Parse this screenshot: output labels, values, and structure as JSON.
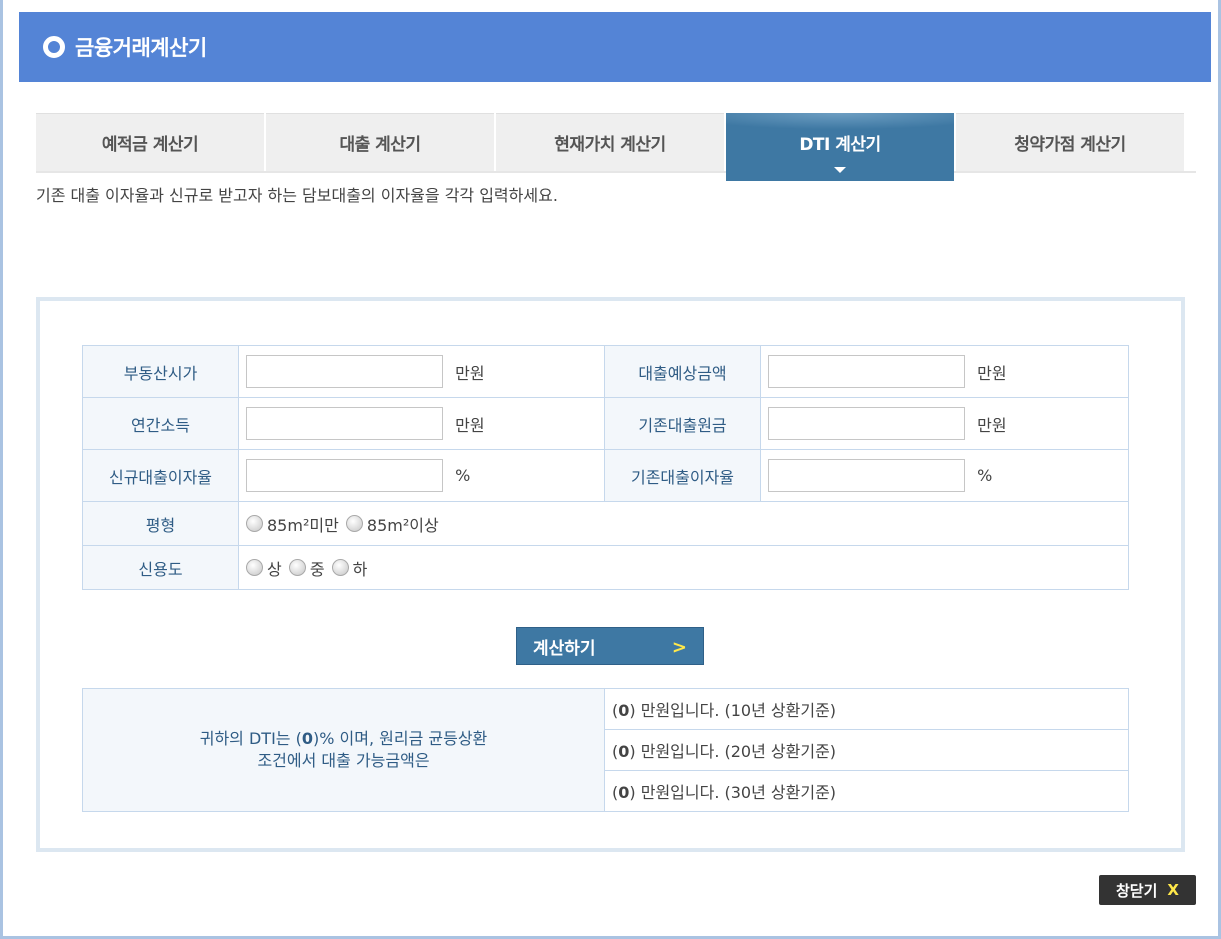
{
  "header": {
    "title": "금융거래계산기"
  },
  "tabs": [
    {
      "label": "예적금 계산기",
      "active": false
    },
    {
      "label": "대출 계산기",
      "active": false
    },
    {
      "label": "현재가치 계산기",
      "active": false
    },
    {
      "label": "DTI 계산기",
      "active": true
    },
    {
      "label": "청약가점 계산기",
      "active": false
    }
  ],
  "instruction": "기존 대출 이자율과 신규로 받고자 하는 담보대출의 이자율을 각각 입력하세요.",
  "form": {
    "property_price": {
      "label": "부동산시가",
      "value": "",
      "unit": "만원"
    },
    "expected_loan": {
      "label": "대출예상금액",
      "value": "",
      "unit": "만원"
    },
    "annual_income": {
      "label": "연간소득",
      "value": "",
      "unit": "만원"
    },
    "existing_principal": {
      "label": "기존대출원금",
      "value": "",
      "unit": "만원"
    },
    "new_rate": {
      "label": "신규대출이자율",
      "value": "",
      "unit": "%"
    },
    "existing_rate": {
      "label": "기존대출이자율",
      "value": "",
      "unit": "%"
    },
    "size": {
      "label": "평형",
      "options": [
        "85m²미만",
        "85m²이상"
      ]
    },
    "credit": {
      "label": "신용도",
      "options": [
        "상",
        "중",
        "하"
      ]
    }
  },
  "calculate_button": {
    "label": "계산하기",
    "icon": "chevron-right-icon"
  },
  "result": {
    "summary_line1_prefix": "귀하의 DTI는 (",
    "summary_value": "0",
    "summary_line1_suffix": ")% 이며, 원리금 균등상환",
    "summary_line2": "조건에서 대출 가능금액은",
    "rows": [
      {
        "value": "0",
        "text": " 만원입니다. (10년 상환기준)"
      },
      {
        "value": "0",
        "text": " 만원입니다. (20년 상환기준)"
      },
      {
        "value": "0",
        "text": " 만원입니다. (30년 상환기준)"
      }
    ]
  },
  "close_button": {
    "label": "창닫기",
    "icon_glyph": "X"
  },
  "colors": {
    "header": "#5484d6",
    "active_tab": "#3e78a3",
    "label_text": "#2f5c85",
    "accent_yellow": "#ffe84a"
  }
}
